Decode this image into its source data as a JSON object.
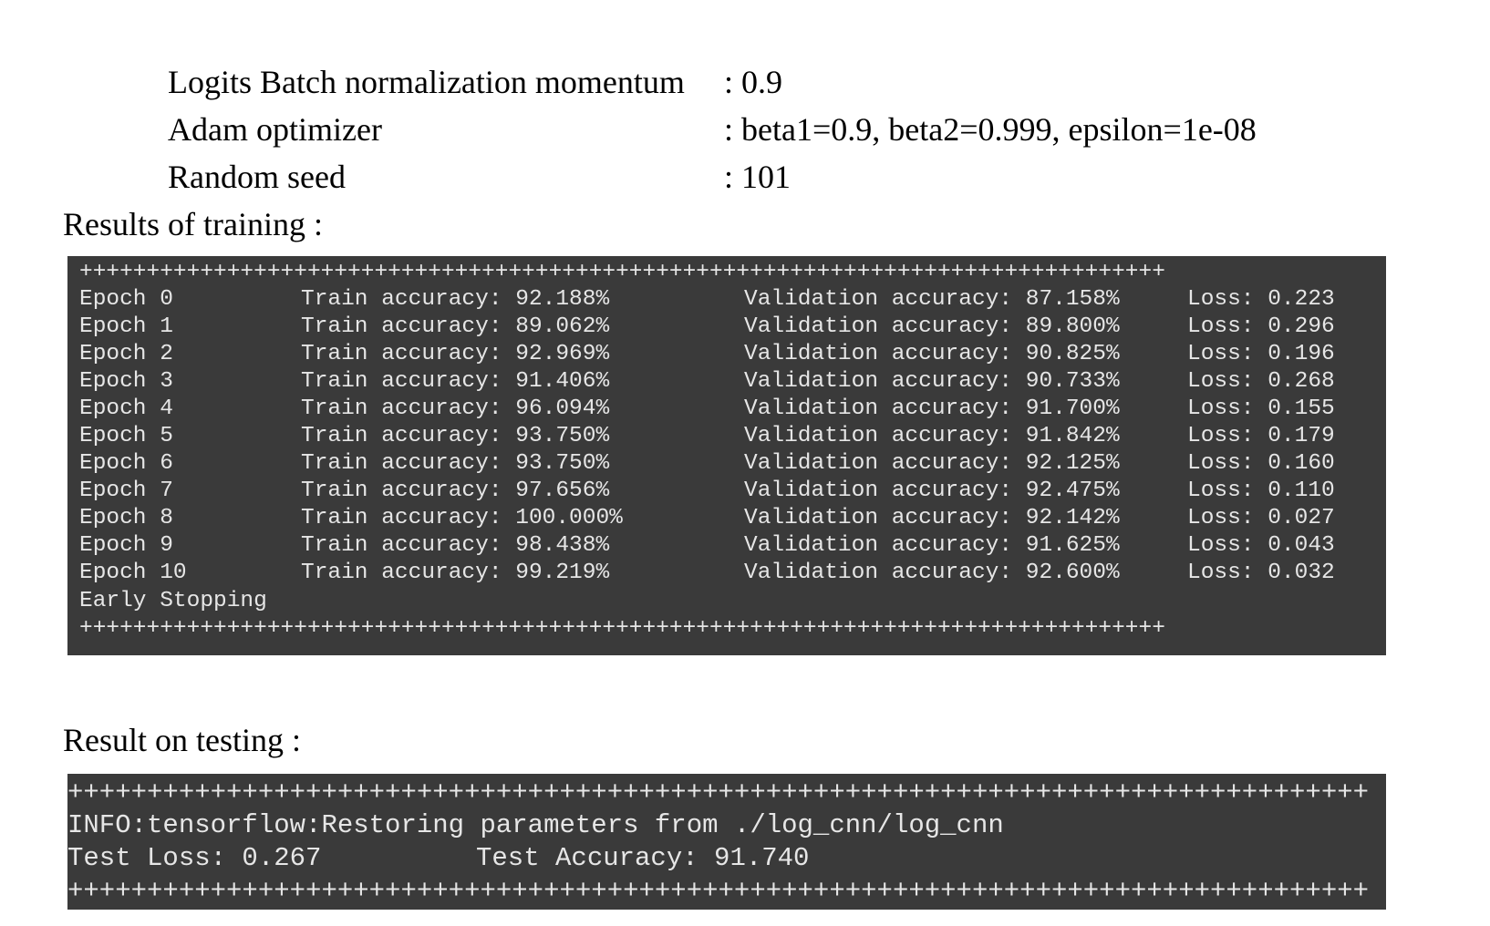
{
  "parameters": [
    {
      "label": "Logits Batch normalization momentum",
      "value": ": 0.9"
    },
    {
      "label": "Adam optimizer",
      "value": ": beta1=0.9, beta2=0.999, epsilon=1e-08"
    },
    {
      "label": "Random seed",
      "value": ": 101"
    }
  ],
  "training": {
    "heading": "Results of training :",
    "border": "+++++++++++++++++++++++++++++++++++++++++++++++++++++++++++++++++++++++++++++++++",
    "epochs": [
      {
        "epoch": "Epoch 0",
        "train": "Train accuracy: 92.188%",
        "val": "Validation accuracy: 87.158%",
        "loss": "Loss: 0.223"
      },
      {
        "epoch": "Epoch 1",
        "train": "Train accuracy: 89.062%",
        "val": "Validation accuracy: 89.800%",
        "loss": "Loss: 0.296"
      },
      {
        "epoch": "Epoch 2",
        "train": "Train accuracy: 92.969%",
        "val": "Validation accuracy: 90.825%",
        "loss": "Loss: 0.196"
      },
      {
        "epoch": "Epoch 3",
        "train": "Train accuracy: 91.406%",
        "val": "Validation accuracy: 90.733%",
        "loss": "Loss: 0.268"
      },
      {
        "epoch": "Epoch 4",
        "train": "Train accuracy: 96.094%",
        "val": "Validation accuracy: 91.700%",
        "loss": "Loss: 0.155"
      },
      {
        "epoch": "Epoch 5",
        "train": "Train accuracy: 93.750%",
        "val": "Validation accuracy: 91.842%",
        "loss": "Loss: 0.179"
      },
      {
        "epoch": "Epoch 6",
        "train": "Train accuracy: 93.750%",
        "val": "Validation accuracy: 92.125%",
        "loss": "Loss: 0.160"
      },
      {
        "epoch": "Epoch 7",
        "train": "Train accuracy: 97.656%",
        "val": "Validation accuracy: 92.475%",
        "loss": "Loss: 0.110"
      },
      {
        "epoch": "Epoch 8",
        "train": "Train accuracy: 100.000%",
        "val": "Validation accuracy: 92.142%",
        "loss": "Loss: 0.027"
      },
      {
        "epoch": "Epoch 9",
        "train": "Train accuracy: 98.438%",
        "val": "Validation accuracy: 91.625%",
        "loss": "Loss: 0.043"
      },
      {
        "epoch": "Epoch 10",
        "train": "Train accuracy: 99.219%",
        "val": "Validation accuracy: 92.600%",
        "loss": "Loss: 0.032"
      }
    ],
    "footer": "Early Stopping"
  },
  "testing": {
    "heading": "Result on testing :",
    "border": "++++++++++++++++++++++++++++++++++++++++++++++++++++++++++++++++++++++++++++++++++",
    "info": "INFO:tensorflow:Restoring parameters from ./log_cnn/log_cnn",
    "test_loss": "Test Loss: 0.267",
    "test_accuracy": "Test Accuracy: 91.740"
  },
  "colors": {
    "console_bg": "#3a3a3a",
    "console_text": "#e6e6e6"
  }
}
